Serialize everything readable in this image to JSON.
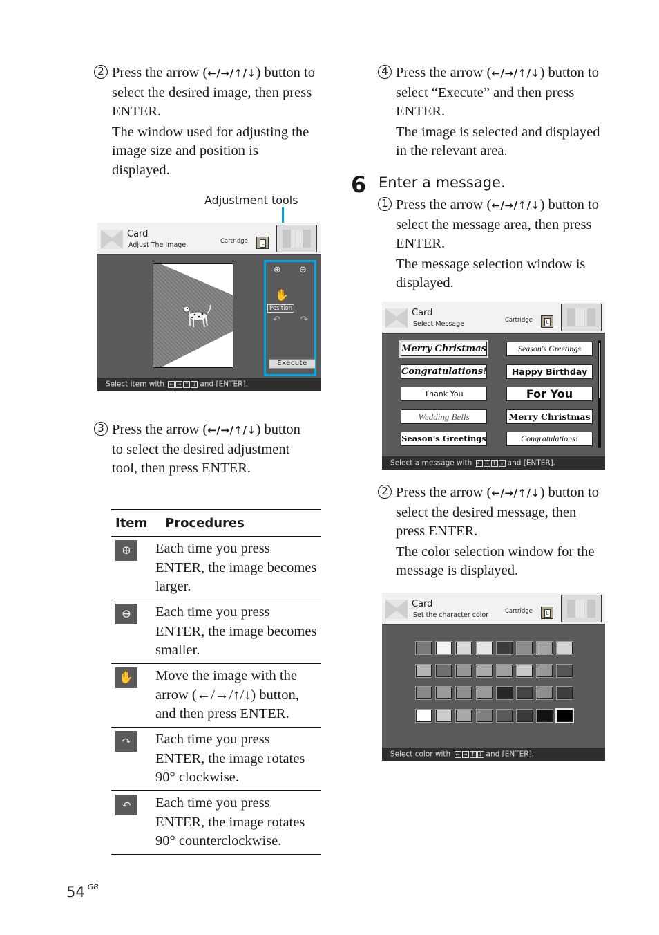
{
  "page": {
    "number": "54",
    "region": "GB",
    "arrow_symbols": "←/→/↑/↓"
  },
  "left": {
    "step2": {
      "num": "2",
      "line1_pre": "Press the arrow (",
      "line1_post": ")",
      "rest": "button to select the desired image, then press ENTER.",
      "note": "The window used for adjusting the image size and position is displayed."
    },
    "callout": "Adjustment tools",
    "step3": {
      "num": "3",
      "line1_pre": "Press the arrow (",
      "line1_post": ")",
      "rest": "button to select the desired adjustment tool, then press ENTER."
    }
  },
  "adjust_screen": {
    "title": "Card",
    "subtitle": "Adjust The Image",
    "cartridge": "Cartridge",
    "cartridge_size": "L",
    "position_label": "Position",
    "execute_label": "Execute",
    "footer_pre": "Select item with",
    "footer_post": "and [ENTER]."
  },
  "table": {
    "headers": [
      "Item",
      "Procedures"
    ],
    "rows": [
      {
        "icon": "zoom-in-icon",
        "glyph": "⊕",
        "text": "Each time you press ENTER, the image becomes larger."
      },
      {
        "icon": "zoom-out-icon",
        "glyph": "⊖",
        "text": "Each time you press ENTER, the image becomes smaller."
      },
      {
        "icon": "hand-icon",
        "glyph": "✋",
        "text": "Move the image with the arrow (←/→/↑/↓) button, and then press ENTER."
      },
      {
        "icon": "rotate-clockwise-icon",
        "glyph": "↷",
        "text": "Each time you press ENTER, the image rotates 90° clockwise."
      },
      {
        "icon": "rotate-counterclockwise-icon",
        "glyph": "↶",
        "text": "Each time you press ENTER, the image rotates 90° counterclockwise."
      }
    ]
  },
  "right": {
    "step4": {
      "num": "4",
      "line1_pre": "Press the arrow (",
      "line1_post": ")",
      "rest": "button to select “Execute” and then press ENTER.",
      "note": "The image is selected and displayed in the relevant area."
    },
    "step6": {
      "num": "6",
      "title": "Enter a message."
    },
    "sub1": {
      "num": "1",
      "line1_pre": "Press the arrow (",
      "line1_post": ")",
      "rest": "button to select the message area, then press ENTER.",
      "note": "The message selection window is displayed."
    },
    "sub2": {
      "num": "2",
      "line1_pre": "Press the arrow (",
      "line1_post": ")",
      "rest": "button to select the desired message, then press ENTER.",
      "note": "The color selection window for the message is displayed."
    }
  },
  "message_screen": {
    "title": "Card",
    "subtitle": "Select Message",
    "cartridge": "Cartridge",
    "cartridge_size": "L",
    "messages": [
      {
        "text": "Merry Christmas",
        "selected": true
      },
      {
        "text": "Season's Greetings",
        "selected": false
      },
      {
        "text": "Congratulations!",
        "selected": false
      },
      {
        "text": "Happy Birthday",
        "selected": false
      },
      {
        "text": "Thank You",
        "selected": false
      },
      {
        "text": "For You",
        "selected": false
      },
      {
        "text": "Wedding Bells",
        "selected": false
      },
      {
        "text": "Merry Christmas",
        "selected": false
      },
      {
        "text": "Season's Greetings",
        "selected": false
      },
      {
        "text": "Congratulations!",
        "selected": false
      }
    ],
    "footer_pre": "Select a message with",
    "footer_post": "and [ENTER]."
  },
  "color_screen": {
    "title": "Card",
    "subtitle": "Set the character color",
    "cartridge": "Cartridge",
    "cartridge_size": "L",
    "swatches": [
      [
        "#7a7a7a",
        "#f4f4f4",
        "#d8d8d8",
        "#e6e6e6",
        "#3c3c3c",
        "#8c8c8c",
        "#a4a4a4",
        "#d4d4d4"
      ],
      [
        "#b4b4b4",
        "#707070",
        "#969696",
        "#aaaaaa",
        "#a0a0a0",
        "#c8c8c8",
        "#989898",
        "#555555"
      ],
      [
        "#888888",
        "#9a9a9a",
        "#8e8e8e",
        "#999999",
        "#262626",
        "#444444",
        "#8e8e8e",
        "#3e3e3e"
      ],
      [
        "#ffffff",
        "#cccccc",
        "#a8a8a8",
        "#808080",
        "#5a5a5a",
        "#3a3a3a",
        "#121212",
        "#000000"
      ]
    ],
    "selected_index": [
      3,
      7
    ],
    "footer_pre": "Select color with",
    "footer_post": "and [ENTER]."
  },
  "colors": {
    "callout_blue": "#00a8e8",
    "screen_bg": "#5a5a5a",
    "footer_bg": "#2e2e2e"
  }
}
